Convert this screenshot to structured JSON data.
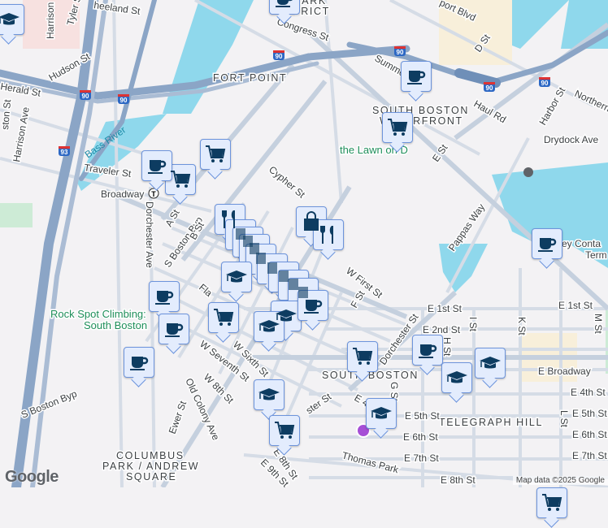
{
  "map": {
    "areas": [
      "FORT POINT",
      "SOUTH BOSTON",
      "WATERFRONT",
      "SOUTH BOSTON",
      "TELEGRAPH HILL",
      "COLUMBUS",
      "PARK / ANDREW",
      "SQUARE",
      "NDMARK",
      "ISTRICT"
    ],
    "pois": [
      "the Lawn on D",
      "Rock Spot Climbing:",
      "South Boston",
      "Thomas Park",
      "Broadway",
      "ey Conta",
      "Term"
    ],
    "river": "Bass River",
    "streets": [
      "Harrison",
      "Tyler St",
      "heeland St",
      "Hudson St",
      "Herald St",
      "Harrison Ave",
      "ston St",
      "Traveler St",
      "Dorchester Ave",
      "A St",
      "S Boston Byp",
      "Cypher St",
      "B St",
      "Congress St",
      "D St",
      "port Blvd",
      "Summer",
      "Haul Rd",
      "Harbor St",
      "Northern",
      "Drydock Ave",
      "E St",
      "Pappas Way",
      "W First St",
      "F St",
      "E 1st St",
      "E 2nd St",
      "Dorchester St",
      "I St",
      "K St",
      "M St",
      "E Broadway",
      "E 4th St",
      "E 5th St",
      "E 6th St",
      "E 7th St",
      "E 8th St",
      "L St",
      "H St",
      "G St",
      "W Seventh St",
      "W Sixth St",
      "W 8th St",
      "Old Colony Ave",
      "Ewer St",
      "E 9th St",
      "Fla",
      "S Boston Byp",
      "E 1st St",
      "E 4th St",
      "E 5th St",
      "E 6th St",
      "E 7th St",
      "E 8th St",
      "ster St"
    ],
    "shields": [
      "90",
      "90",
      "90",
      "90",
      "90",
      "93"
    ],
    "transit_label": "T"
  },
  "markers": [
    "school",
    "coffee",
    "cart",
    "coffee",
    "coffee",
    "cart",
    "cart",
    "restaurant",
    "shopping",
    "restaurant",
    "cluster",
    "school",
    "coffee",
    "coffee",
    "coffee",
    "cart",
    "school",
    "school",
    "coffee",
    "cart",
    "coffee",
    "school",
    "school",
    "school",
    "school",
    "cart",
    "school"
  ],
  "footer": {
    "logo": "Google",
    "credit": "Map data ©2025 Google"
  },
  "colors": {
    "water": "#8fd8ec",
    "highway": "#8ba5c6",
    "marker_bg": "#e3ecfd",
    "marker_border": "#6d94dc",
    "icon": "#0d3c61"
  }
}
